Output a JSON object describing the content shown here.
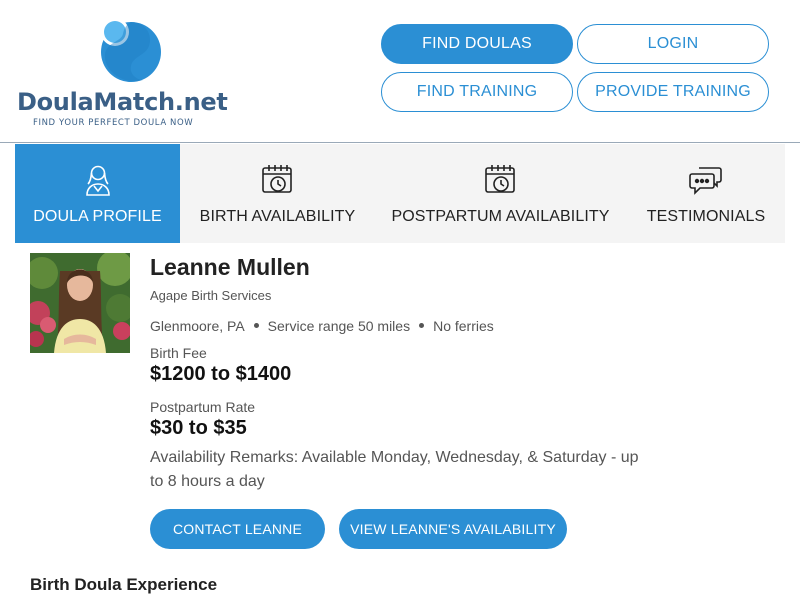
{
  "brand": {
    "name_part1": "DoulaMatch",
    "name_part2": ".net",
    "tagline": "FIND YOUR PERFECT DOULA NOW",
    "colors": {
      "primary": "#2b8fd4",
      "logo_dark": "#3a5f86",
      "logo_light": "#5ab8ef"
    }
  },
  "header_nav": {
    "find_doulas": "FIND DOULAS",
    "login": "LOGIN",
    "find_training": "FIND TRAINING",
    "provide_training": "PROVIDE TRAINING"
  },
  "tabs": [
    {
      "label": "DOULA PROFILE",
      "icon": "doula-person-icon",
      "active": true
    },
    {
      "label": "BIRTH AVAILABILITY",
      "icon": "calendar-clock-icon",
      "active": false
    },
    {
      "label": "POSTPARTUM AVAILABILITY",
      "icon": "calendar-clock-icon",
      "active": false
    },
    {
      "label": "TESTIMONIALS",
      "icon": "chat-bubbles-icon",
      "active": false
    }
  ],
  "profile": {
    "name": "Leanne Mullen",
    "agency": "Agape Birth Services",
    "location": "Glenmoore, PA",
    "service_range": "Service range 50 miles",
    "ferries": "No ferries",
    "birth_fee_label": "Birth Fee",
    "birth_fee_value": "$1200 to $1400",
    "postpartum_rate_label": "Postpartum Rate",
    "postpartum_rate_value": "$30 to $35",
    "availability_remarks": "Availability Remarks: Available Monday, Wednesday, & Saturday - up to 8 hours a day",
    "contact_button": "CONTACT LEANNE",
    "availability_button": "VIEW LEANNE'S AVAILABILITY"
  },
  "sections": {
    "birth_experience_title": "Birth Doula Experience"
  }
}
